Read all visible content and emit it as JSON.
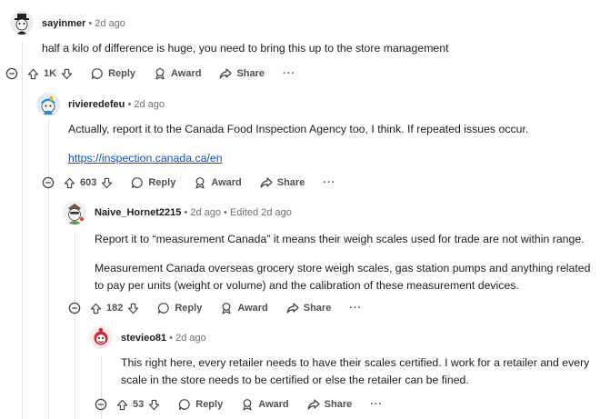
{
  "comments": [
    {
      "username": "sayinmer",
      "meta": "• 2d ago",
      "paragraphs": [
        "half a kilo of difference is huge, you need to bring this up to the store management"
      ],
      "score": "1K",
      "actions": {
        "reply": "Reply",
        "award": "Award",
        "share": "Share",
        "more": "···"
      }
    },
    {
      "username": "rivieredefeu",
      "meta": "• 2d ago",
      "paragraphs": [
        "Actually, report it to the Canada Food Inspection Agency too, I think. If repeated issues occur."
      ],
      "link": "https://inspection.canada.ca/en",
      "score": "603",
      "actions": {
        "reply": "Reply",
        "award": "Award",
        "share": "Share",
        "more": "···"
      }
    },
    {
      "username": "Naive_Hornet2215",
      "meta": "• 2d ago • Edited 2d ago",
      "paragraphs": [
        "Report it to “measurement Canada” it means their weigh scales used for trade are not within range.",
        "Measurement Canada overseas grocery store weigh scales, gas station pumps and anything related to pay per units (weight or volume) and the calibration of these measurement devices."
      ],
      "score": "182",
      "actions": {
        "reply": "Reply",
        "award": "Award",
        "share": "Share",
        "more": "···"
      }
    },
    {
      "username": "stevieo81",
      "meta": "• 2d ago",
      "paragraphs": [
        "This right here, every retailer needs to have their scales certified. I work for a retailer and every scale in the store needs to be certified or else the retailer can be fined."
      ],
      "score": "53",
      "actions": {
        "reply": "Reply",
        "award": "Award",
        "share": "Share",
        "more": "···"
      }
    }
  ]
}
